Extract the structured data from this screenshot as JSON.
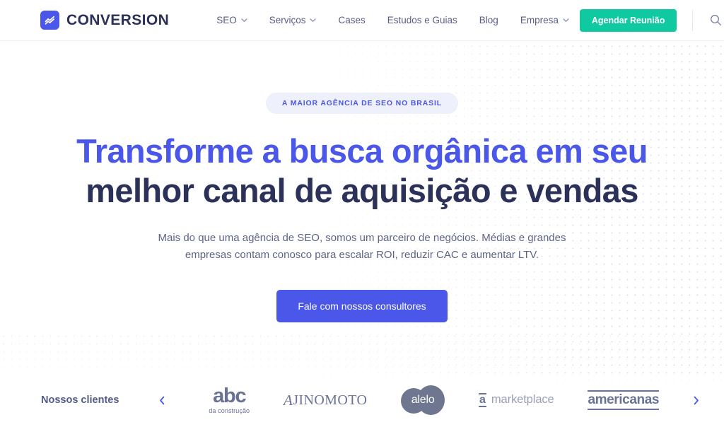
{
  "colors": {
    "brand_indigo": "#4a57e8",
    "brand_navy": "#2b3158",
    "accent_teal": "#0fc9a0",
    "badge_bg": "#eef0fb",
    "body_text": "#5d6486",
    "logo_gray": "#6a7296"
  },
  "header": {
    "brand_name": "CONVERSION",
    "brand_icon": "chart-line-icon",
    "nav": [
      {
        "label": "SEO",
        "has_dropdown": true
      },
      {
        "label": "Serviços",
        "has_dropdown": true
      },
      {
        "label": "Cases",
        "has_dropdown": false
      },
      {
        "label": "Estudos e Guias",
        "has_dropdown": false
      },
      {
        "label": "Blog",
        "has_dropdown": false
      },
      {
        "label": "Empresa",
        "has_dropdown": true
      }
    ],
    "cta_label": "Agendar Reunião",
    "search_icon": "search-icon"
  },
  "hero": {
    "badge": "A MAIOR AGÊNCIA DE SEO NO BRASIL",
    "headline_line1": "Transforme a busca orgânica em seu",
    "headline_line2": "melhor canal de aquisição e vendas",
    "subheading": "Mais do que uma agência de SEO, somos um parceiro de negócios. Médias e grandes empresas contam conosco para escalar ROI, reduzir CAC e aumentar LTV.",
    "cta_label": "Fale com nossos consultores"
  },
  "clients": {
    "label": "Nossos clientes",
    "prev_icon": "chevron-left-icon",
    "next_icon": "chevron-right-icon",
    "logos": [
      {
        "name": "abc-da-construcao",
        "main": "abc",
        "sub": "da construção"
      },
      {
        "name": "ajinomoto",
        "lead": "A",
        "rest": "JINOMOTO"
      },
      {
        "name": "alelo",
        "text": "alelo"
      },
      {
        "name": "marketplace",
        "mark": "a",
        "word": "marketplace"
      },
      {
        "name": "americanas",
        "text": "americanas"
      }
    ]
  }
}
